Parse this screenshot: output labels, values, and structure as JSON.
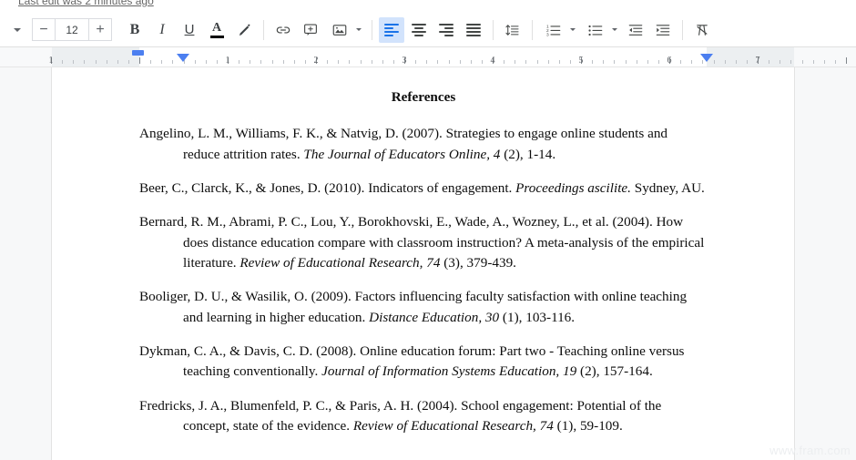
{
  "status": {
    "last_edit": "Last edit was 2 minutes ago"
  },
  "toolbar": {
    "styles_caret": "chevron-down",
    "font_size_decrease": "−",
    "font_size_value": "12",
    "font_size_increase": "+",
    "bold": "B",
    "italic": "I",
    "underline": "U",
    "text_color": "A",
    "highlight": "highlight-pen",
    "insert_link": "link",
    "add_comment": "comment-plus",
    "insert_image": "image",
    "align_left": "align-left",
    "align_center": "align-center",
    "align_right": "align-right",
    "align_justify": "align-justify",
    "line_spacing": "line-spacing",
    "numbered_list": "numbered-list",
    "bulleted_list": "bulleted-list",
    "decrease_indent": "decrease-indent",
    "increase_indent": "increase-indent",
    "clear_formatting": "clear-formatting",
    "active_alignment": "align_left",
    "accent_color": "#1a73e8"
  },
  "ruler": {
    "labels": [
      "1",
      "1",
      "2",
      "3",
      "4",
      "5",
      "6",
      "7"
    ],
    "marker_color": "#4c7ff0",
    "first_line_indent": "first-line-indent-marker",
    "left_indent": "left-indent-marker",
    "right_indent": "right-indent-marker"
  },
  "document": {
    "title": "References",
    "references": [
      {
        "authors_year": "Angelino, L. M., Williams, F. K., & Natvig, D. (2007). Strategies to engage online students and reduce attrition rates. ",
        "source_italic": "The Journal of Educators Online, 4",
        "tail": " (2), 1-14."
      },
      {
        "authors_year": "Beer, C., Clarck, K., & Jones, D. (2010). Indicators of engagement. ",
        "source_italic": "Proceedings ascilite.",
        "tail": " Sydney, AU."
      },
      {
        "authors_year": "Bernard, R. M., Abrami, P. C., Lou, Y., Borokhovski, E., Wade, A., Wozney, L., et al. (2004). How does distance education compare with classroom instruction? A meta-analysis of the empirical literature. ",
        "source_italic": "Review of Educational Research, 74",
        "tail": " (3), 379-439."
      },
      {
        "authors_year": "Booliger, D. U., & Wasilik, O. (2009). Factors influencing faculty satisfaction with online teaching and learning in higher education. ",
        "source_italic": "Distance Education, 30",
        "tail": " (1), 103-116."
      },
      {
        "authors_year": "Dykman, C. A., & Davis, C. D. (2008). Online education forum: Part two - Teaching online versus teaching conventionally. ",
        "source_italic": "Journal of Information Systems Education, 19",
        "tail": " (2), 157-164."
      },
      {
        "authors_year": "Fredricks, J. A., Blumenfeld, P. C., & Paris, A. H. (2004). School engagement: Potential of the concept, state of the evidence. ",
        "source_italic": "Review of Educational Research, 74",
        "tail": " (1), 59-109."
      }
    ]
  },
  "watermark": {
    "text": "www.fram.com"
  }
}
